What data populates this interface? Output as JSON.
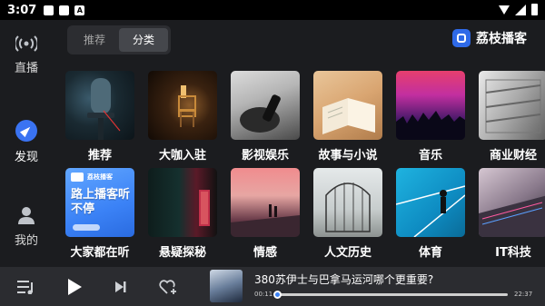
{
  "status": {
    "time": "3:07"
  },
  "sidebar": {
    "items": [
      {
        "label": "直播",
        "icon": "broadcast-icon"
      },
      {
        "label": "发现",
        "icon": "compass-icon",
        "active": true
      },
      {
        "label": "我的",
        "icon": "person-icon"
      }
    ]
  },
  "tabs": [
    {
      "label": "推荐"
    },
    {
      "label": "分类",
      "active": true
    }
  ],
  "brand": {
    "name": "荔枝播客",
    "color": "#2f6ae8"
  },
  "categories": [
    {
      "label": "推荐"
    },
    {
      "label": "大咖入驻"
    },
    {
      "label": "影视娱乐"
    },
    {
      "label": "故事与小说"
    },
    {
      "label": "音乐"
    },
    {
      "label": "商业财经"
    },
    {
      "label": "大家都在听",
      "promo": {
        "top": "荔枝播客",
        "text": "路上播客听不停"
      }
    },
    {
      "label": "悬疑探秘"
    },
    {
      "label": "情感"
    },
    {
      "label": "人文历史"
    },
    {
      "label": "体育"
    },
    {
      "label": "IT科技"
    }
  ],
  "player": {
    "title": "380苏伊士与巴拿马运河哪个更重要?",
    "current_time": "00:11",
    "duration": "22:37",
    "progress": 0.008,
    "accent": "#3b82f6"
  }
}
